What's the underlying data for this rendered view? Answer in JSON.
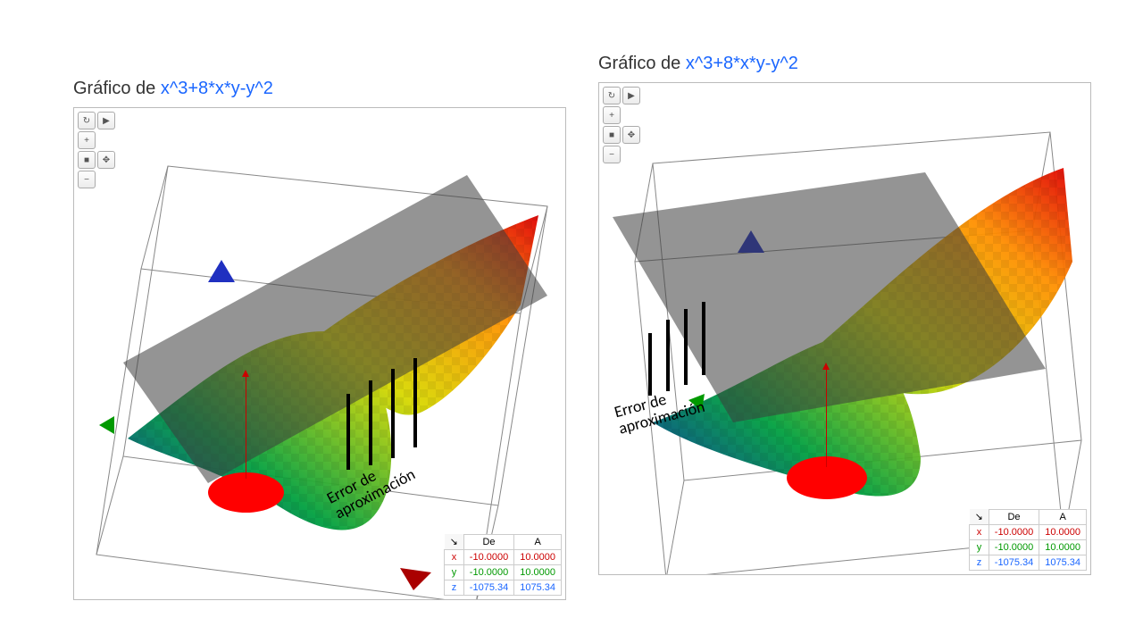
{
  "chart_data": [
    {
      "type": "surface",
      "title_prefix": "Gráfico de ",
      "formula": "x^3+8*x*y-y^2",
      "annotation": "Error de\naproximación",
      "axes": {
        "headers": [
          "De",
          "A"
        ],
        "x": {
          "label": "x",
          "from": "-10.0000",
          "to": "10.0000"
        },
        "y": {
          "label": "y",
          "from": "-10.0000",
          "to": "10.0000"
        },
        "z": {
          "label": "z",
          "from": "-1075.34",
          "to": "1075.34"
        }
      },
      "tangent_plane": "shown",
      "view_rotation_deg": -20
    },
    {
      "type": "surface",
      "title_prefix": "Gráfico de ",
      "formula": "x^3+8*x*y-y^2",
      "annotation": "Error de\naproximación",
      "axes": {
        "headers": [
          "De",
          "A"
        ],
        "x": {
          "label": "x",
          "from": "-10.0000",
          "to": "10.0000"
        },
        "y": {
          "label": "y",
          "from": "-10.0000",
          "to": "10.0000"
        },
        "z": {
          "label": "z",
          "from": "-1075.34",
          "to": "1075.34"
        }
      },
      "tangent_plane": "shown",
      "view_rotation_deg": 5
    }
  ],
  "toolbar": {
    "reset": "↻",
    "play": "▶",
    "zoom_in": "+",
    "move3d": "✥",
    "camera": "■",
    "zoom_out": "−"
  }
}
